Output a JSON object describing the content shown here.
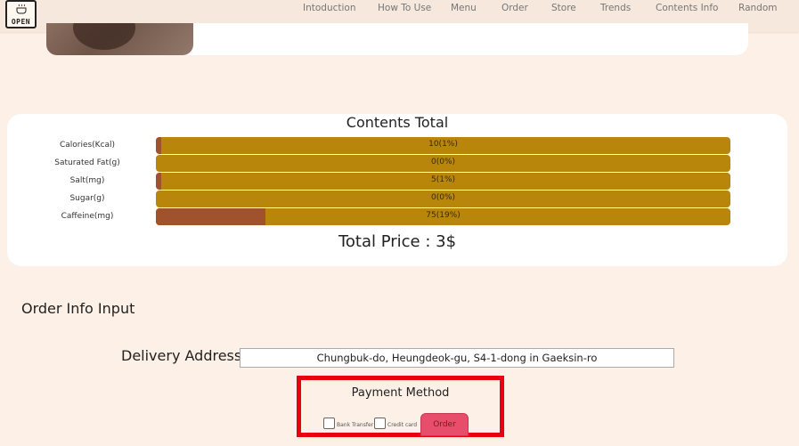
{
  "logo": {
    "text": "OPEN",
    "icon": "coffee-cup-icon"
  },
  "nav": {
    "items": [
      "Intoduction",
      "How To Use",
      "Menu",
      "Order",
      "Store",
      "Trends",
      "Contents Info",
      "Random"
    ]
  },
  "contents": {
    "title": "Contents Total",
    "rows": [
      {
        "label": "Calories(Kcal)",
        "value_text": "10(1%)",
        "percent": 1
      },
      {
        "label": "Saturated Fat(g)",
        "value_text": "0(0%)",
        "percent": 0
      },
      {
        "label": "Salt(mg)",
        "value_text": "5(1%)",
        "percent": 1
      },
      {
        "label": "Sugar(g)",
        "value_text": "0(0%)",
        "percent": 0
      },
      {
        "label": "Caffeine(mg)",
        "value_text": "75(19%)",
        "percent": 19
      }
    ],
    "total_price": "Total Price : 3$"
  },
  "order_info": {
    "heading": "Order Info Input",
    "address_label": "Delivery Address :",
    "address_value": "Chungbuk-do, Heungdeok-gu, S4-1-dong in Gaeksin-ro",
    "payment": {
      "title": "Payment Method",
      "bank_transfer_label": "Bank Transfer",
      "credit_card_label": "Credit card",
      "order_button": "Order"
    }
  },
  "colors": {
    "background": "#fdf0e6",
    "bar_track": "#b8860b",
    "bar_fill": "#a0522d",
    "order_button": "#e84d6b",
    "highlight_border": "#e8000e"
  }
}
